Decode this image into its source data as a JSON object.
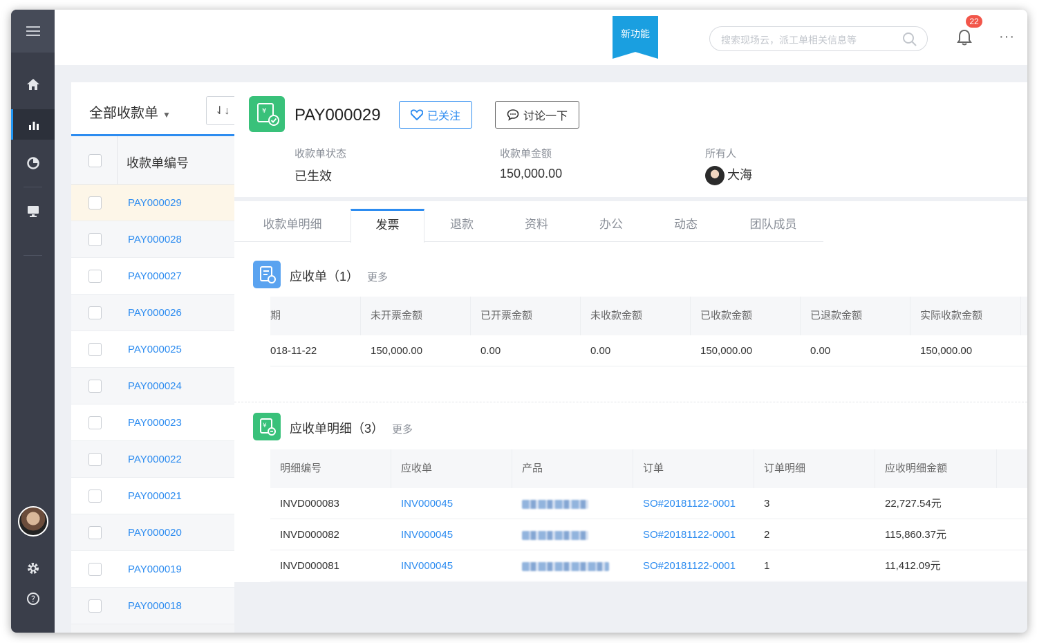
{
  "topbar": {
    "new_feature": "新功能",
    "search_placeholder": "搜索现场云，派工单相关信息等",
    "notifications": "22",
    "more": "···"
  },
  "list": {
    "title": "全部收款单",
    "column_header": "收款单编号",
    "items": [
      "PAY000029",
      "PAY000028",
      "PAY000027",
      "PAY000026",
      "PAY000025",
      "PAY000024",
      "PAY000023",
      "PAY000022",
      "PAY000021",
      "PAY000020",
      "PAY000019",
      "PAY000018"
    ]
  },
  "record": {
    "title": "PAY000029",
    "follow_label": "已关注",
    "discuss_label": "讨论一下",
    "status_label": "收款单状态",
    "status_value": "已生效",
    "amount_label": "收款单金额",
    "amount_value": "150,000.00",
    "owner_label": "所有人",
    "owner_value": "大海"
  },
  "tabs": [
    "收款单明细",
    "发票",
    "退款",
    "资料",
    "办公",
    "动态",
    "团队成员"
  ],
  "receivable": {
    "title": "应收单（1）",
    "more": "更多",
    "headers": [
      "期",
      "未开票金额",
      "已开票金额",
      "未收款金额",
      "已收款金额",
      "已退款金额",
      "实际收款金额"
    ],
    "rows": [
      [
        "018-11-22",
        "150,000.00",
        "0.00",
        "0.00",
        "150,000.00",
        "0.00",
        "150,000.00"
      ]
    ]
  },
  "receivable_detail": {
    "title": "应收单明细（3）",
    "more": "更多",
    "headers": [
      "明细编号",
      "应收单",
      "产品",
      "订单",
      "订单明细",
      "应收明细金额"
    ],
    "rows": [
      [
        "INVD000083",
        "INV000045",
        "",
        "SO#20181122-0001",
        "3",
        "22,727.54元"
      ],
      [
        "INVD000082",
        "INV000045",
        "",
        "SO#20181122-0001",
        "2",
        "115,860.37元"
      ],
      [
        "INVD000081",
        "INV000045",
        "",
        "SO#20181122-0001",
        "1",
        "11,412.09元"
      ]
    ]
  },
  "colors": {
    "accent": "#2d8cf0",
    "rail": "#3a3e4a",
    "green": "#39c17a",
    "badge": "#f2564a"
  }
}
